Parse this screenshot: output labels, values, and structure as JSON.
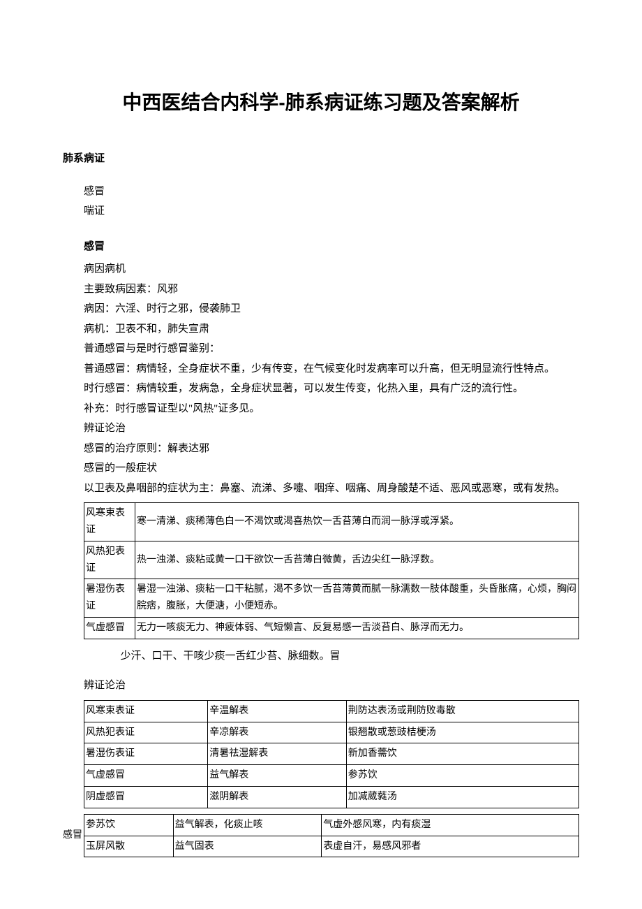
{
  "title": "中西医结合内科学-肺系病证练习题及答案解析",
  "section_heading": "肺系病证",
  "intro_items": [
    "感冒",
    "喘证"
  ],
  "ganmao": {
    "heading": "感冒",
    "lines": [
      "病因病机",
      "主要致病因素：风邪",
      "病因：六淫、时行之邪，侵袭肺卫",
      "病机：卫表不和，肺失宣肃",
      "普通感冒与是时行感冒鉴别：",
      "普通感冒：病情轻，全身症状不重，少有传变，在气候变化时发病率可以升高，但无明显流行性特点。",
      "时行感冒：病情较重，发病急，全身症状显著，可以发生传变，化热入里，具有广泛的流行性。",
      "补充：时行感冒证型以\"风热\"证多见。",
      "辨证论治",
      "感冒的治疗原则：解表达邪",
      "感冒的一般症状",
      "以卫表及鼻咽部的症状为主：鼻塞、流涕、多嚏、咽痒、咽痛、周身酸楚不适、恶风或恶寒，或有发热。"
    ],
    "table1": [
      {
        "name": "风寒束表证",
        "desc": "寒一清涕、痰稀薄色白一不渴饮或渴喜热饮一舌苔薄白而润一脉浮或浮紧。"
      },
      {
        "name": "风热犯表证",
        "desc": "热一浊涕、痰粘或黄一口干欲饮一舌苔薄白微黄，舌边尖红一脉浮数。"
      },
      {
        "name": "暑湿伤表证",
        "desc": "暑湿一浊涕、痰粘一口干粘腻，渴不多饮一舌苔薄黄而腻一脉濡数一肢体酸重，头昏胀痛，心烦，胸闷脘痞，腹胀，大便溏，小便短赤。"
      },
      {
        "name": "气虚感冒",
        "desc": "无力一咳痰无力、神疲体弱、气短懒言、反复易感一舌淡苔白、脉浮而无力。"
      }
    ],
    "fragment": "少汗、口干、干咳少痰一舌红少苔、脉细数。冒",
    "bzlz_heading": "辨证论治",
    "table2": [
      {
        "c1": "风寒束表证",
        "c2": "辛温解表",
        "c3": "荆防达表汤或荆防败毒散"
      },
      {
        "c1": "风热犯表证",
        "c2": "辛凉解表",
        "c3": "银翘散或葱豉桔梗汤"
      },
      {
        "c1": "暑湿伤表证",
        "c2": "清暑祛湿解表",
        "c3": "新加香薷饮"
      },
      {
        "c1": "气虚感冒",
        "c2": "益气解表",
        "c3": "参苏饮"
      },
      {
        "c1": "阴虚感冒",
        "c2": "滋阴解表",
        "c3": "加减葳蕤汤"
      }
    ],
    "ganmao_label": "感冒",
    "table3": [
      {
        "c1": "参苏饮",
        "c2": "益气解表，化痰止咳",
        "c3": "气虚外感风寒，内有痰湿"
      },
      {
        "c1": "玉屏风散",
        "c2": "益气固表",
        "c3": "表虚自汗，易感风邪者"
      }
    ]
  }
}
